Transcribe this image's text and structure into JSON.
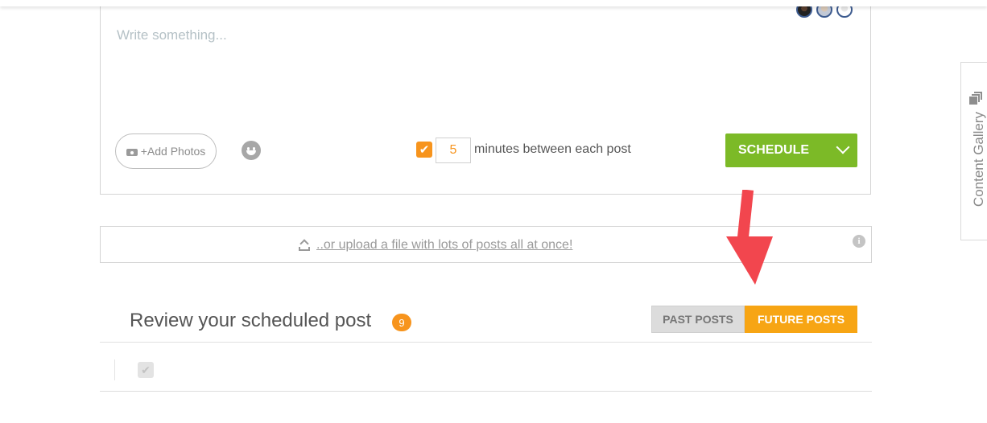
{
  "composer": {
    "placeholder": "Write something...",
    "add_photos_label": "+Add Photos",
    "interval_checked": true,
    "interval_value": "5",
    "interval_label": "minutes between each post",
    "schedule_label": "SCHEDULE"
  },
  "upload": {
    "link_text": "..or upload a file with lots of posts all at once!",
    "info_glyph": "i"
  },
  "review": {
    "title": "Review your scheduled post",
    "count": "9",
    "tabs": {
      "past": "PAST POSTS",
      "future": "FUTURE POSTS"
    },
    "active_tab": "future"
  },
  "sidebar": {
    "gallery_label": "Content Gallery"
  },
  "colors": {
    "accent_orange": "#f7941d",
    "schedule_green": "#7cba27",
    "annotation_red": "#f2464e"
  },
  "icons": [
    "camera-icon",
    "emoji-icon",
    "upload-icon",
    "info-icon",
    "chevron-down-icon",
    "gallery-icon"
  ]
}
